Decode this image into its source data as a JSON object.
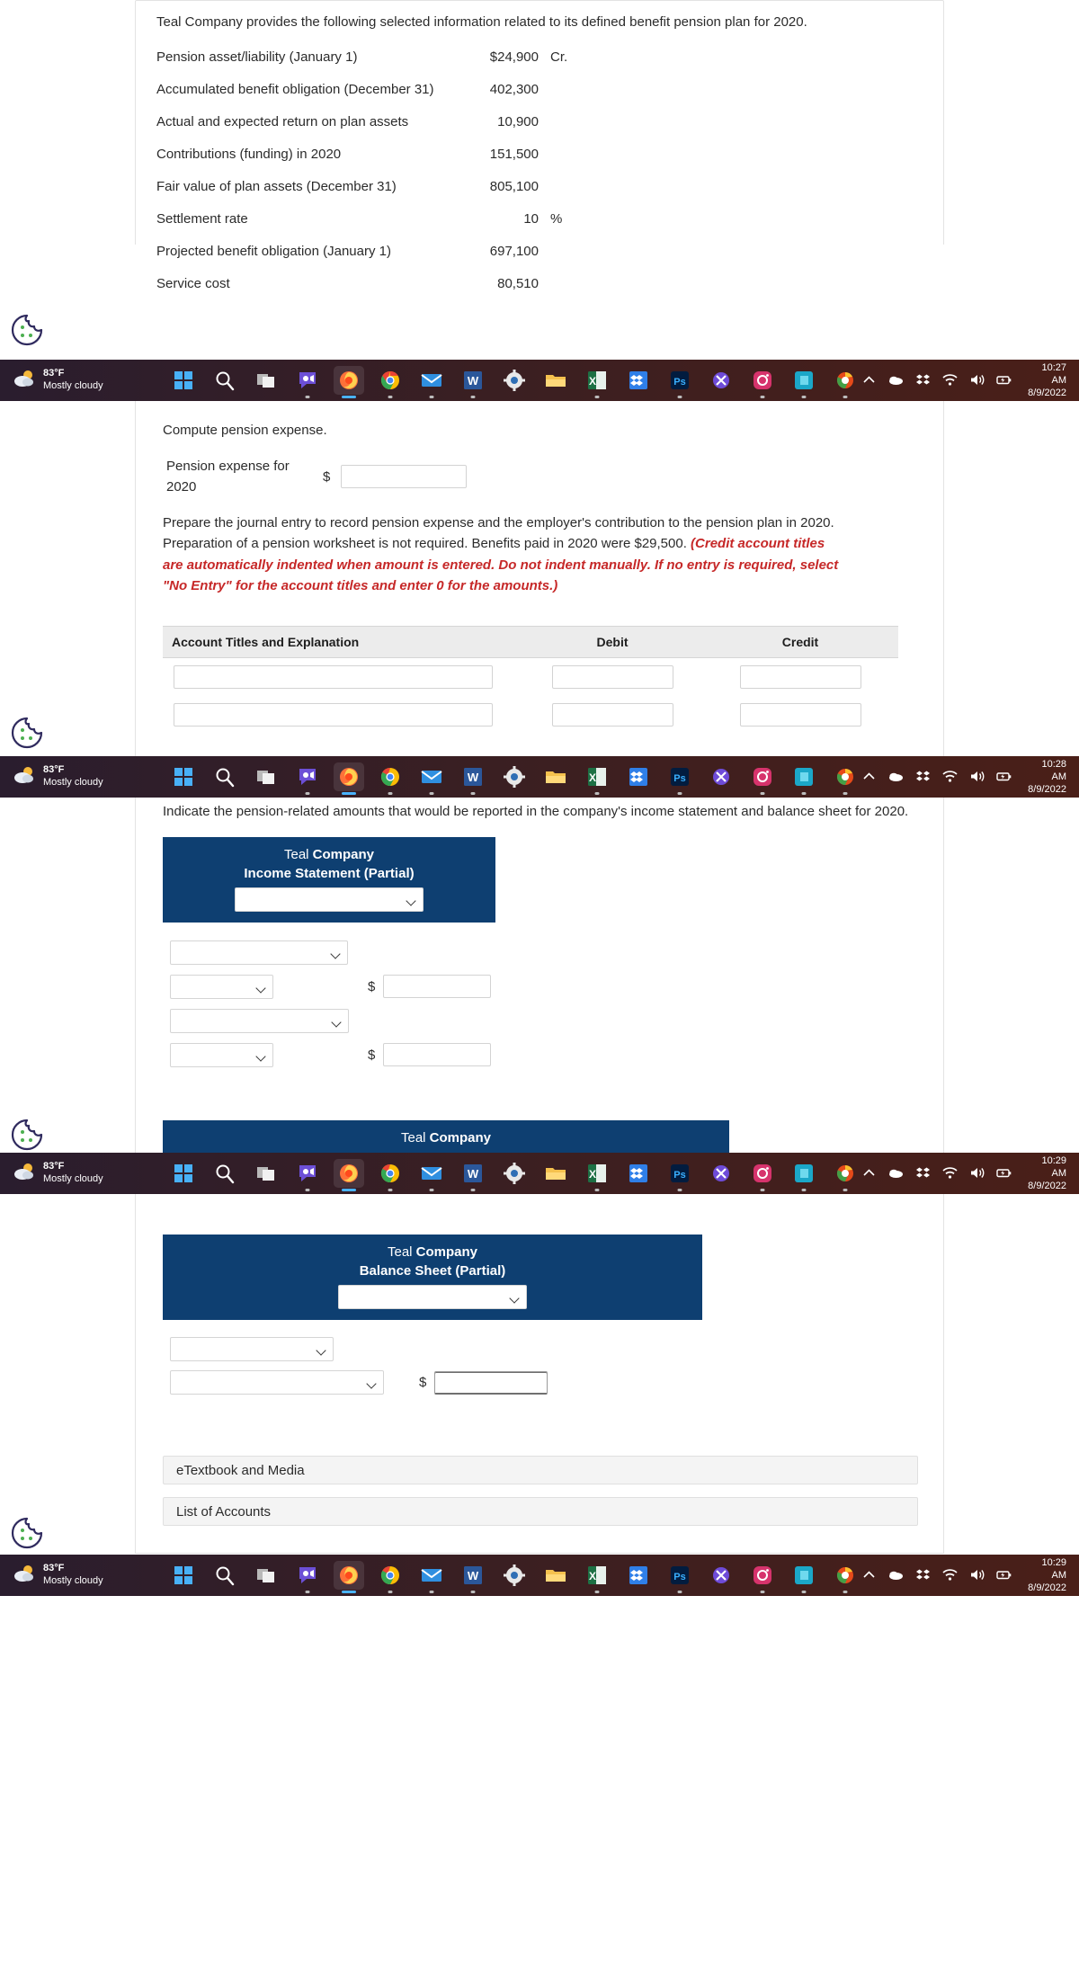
{
  "intro": {
    "prompt": "Teal Company provides the following selected information related to its defined benefit pension plan for 2020.",
    "rows": [
      {
        "label": "Pension asset/liability (January 1)",
        "value": "$24,900",
        "suffix": "Cr."
      },
      {
        "label": "Accumulated benefit obligation (December 31)",
        "value": "402,300",
        "suffix": ""
      },
      {
        "label": "Actual and expected return on plan assets",
        "value": "10,900",
        "suffix": ""
      },
      {
        "label": "Contributions (funding) in 2020",
        "value": "151,500",
        "suffix": ""
      },
      {
        "label": "Fair value of plan assets (December 31)",
        "value": "805,100",
        "suffix": ""
      },
      {
        "label": "Settlement rate",
        "value": "10",
        "suffix": "%"
      },
      {
        "label": "Projected benefit obligation (January 1)",
        "value": "697,100",
        "suffix": ""
      },
      {
        "label": "Service cost",
        "value": "80,510",
        "suffix": ""
      }
    ]
  },
  "part_a": {
    "prompt": "Compute pension expense.",
    "field_label": "Pension expense for 2020",
    "currency": "$",
    "value": ""
  },
  "part_b": {
    "prompt_plain_1": "Prepare the journal entry to record pension expense and the employer's contribution to the pension plan in 2020. Preparation of a pension worksheet is not required. Benefits paid in 2020 were $29,500. ",
    "prompt_emph": "(Credit account titles are automatically indented when amount is entered. Do not indent manually. If no entry is required, select \"No Entry\" for the account titles and enter 0 for the amounts.)",
    "emph_color": "#c62828",
    "table": {
      "headers": [
        "Account Titles and Explanation",
        "Debit",
        "Credit"
      ],
      "rows": [
        {
          "account": "",
          "debit": "",
          "credit": ""
        },
        {
          "account": "",
          "debit": "",
          "credit": ""
        }
      ]
    }
  },
  "part_c": {
    "prompt": "Indicate the pension-related amounts that would be reported in the company's income statement and balance sheet for 2020.",
    "income_statement": {
      "company": "Teal ",
      "company_bold": "Company",
      "subtitle": "Income Statement (Partial)",
      "header_select": "",
      "lines": [
        {
          "select": "",
          "currency": "",
          "amount": "",
          "wide": true
        },
        {
          "select": "",
          "currency": "$",
          "amount": "",
          "wide": false
        },
        {
          "select": "",
          "currency": "",
          "amount": "",
          "wide": true
        },
        {
          "select": "",
          "currency": "$",
          "amount": "",
          "wide": false
        }
      ]
    },
    "second_header": {
      "company": "Teal ",
      "company_bold": "Company"
    },
    "balance_sheet": {
      "company": "Teal ",
      "company_bold": "Company",
      "subtitle": "Balance Sheet (Partial)",
      "header_select": "",
      "lines": [
        {
          "select": "",
          "currency": "",
          "amount": "",
          "wide": false
        },
        {
          "select": "",
          "currency": "$",
          "amount": "",
          "wide": true
        }
      ]
    }
  },
  "footer_buttons": [
    {
      "label": "eTextbook and Media"
    },
    {
      "label": "List of Accounts"
    }
  ],
  "taskbars": [
    {
      "temp": "83°F",
      "condition": "Mostly cloudy",
      "time": "10:27 AM",
      "date": "8/9/2022"
    },
    {
      "temp": "83°F",
      "condition": "Mostly cloudy",
      "time": "10:28 AM",
      "date": "8/9/2022"
    },
    {
      "temp": "83°F",
      "condition": "Mostly cloudy",
      "time": "10:29 AM",
      "date": "8/9/2022"
    },
    {
      "temp": "83°F",
      "condition": "Mostly cloudy",
      "time": "10:29 AM",
      "date": "8/9/2022"
    }
  ],
  "taskbar_icons": [
    "windows-start-icon",
    "search-icon",
    "task-view-icon",
    "teams-chat-icon",
    "firefox-icon",
    "chrome-icon",
    "mail-icon",
    "word-icon",
    "settings-icon",
    "file-explorer-icon",
    "excel-icon",
    "dropbox-icon",
    "photoshop-icon",
    "xd-icon",
    "instagram-icon",
    "evernote-icon",
    "app-icon"
  ],
  "tray_icons": [
    "chevron-up-icon",
    "onedrive-icon",
    "dropbox-tray-icon",
    "wifi-icon",
    "volume-icon",
    "battery-icon"
  ],
  "cookie_badge": {
    "icon": "cookie-icon",
    "color": "#2f2a5e",
    "dot_color": "#4caf50"
  }
}
